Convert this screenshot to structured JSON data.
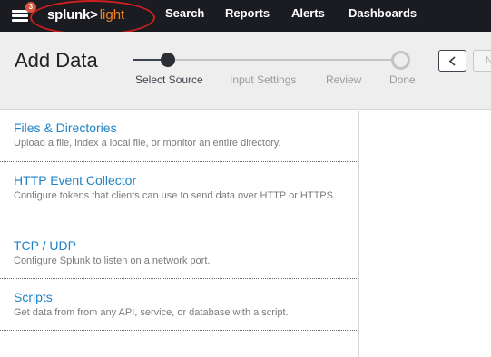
{
  "topbar": {
    "notification_count": "3",
    "brand_primary": "splunk>",
    "brand_secondary": "light",
    "brand_color": "#f58220",
    "nav": [
      "Search",
      "Reports",
      "Alerts",
      "Dashboards"
    ]
  },
  "header": {
    "title": "Add Data",
    "steps": [
      "Select Source",
      "Input Settings",
      "Review",
      "Done"
    ],
    "active_step": "Select Source",
    "back_icon": "chevron-left-icon",
    "next_label": "Next"
  },
  "sources": [
    {
      "title": "Files & Directories",
      "description": "Upload a file, index a local file, or monitor an entire directory."
    },
    {
      "title": "HTTP Event Collector",
      "description": "Configure tokens that clients can use to send data over HTTP or HTTPS."
    },
    {
      "title": "TCP / UDP",
      "description": "Configure Splunk to listen on a network port."
    },
    {
      "title": "Scripts",
      "description": "Get data from from any API, service, or database with a script."
    }
  ],
  "colors": {
    "topbar": "#1a1c21",
    "link": "#1e83c6",
    "annotation": "#cc1f1f"
  }
}
